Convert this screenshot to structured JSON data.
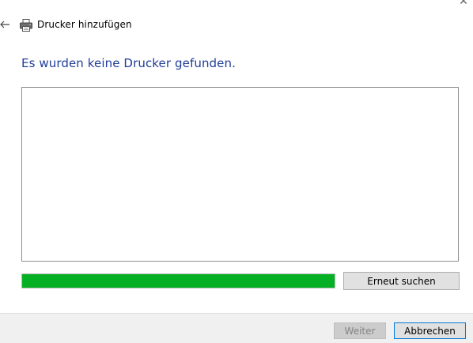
{
  "window": {
    "close_icon": "close-icon",
    "close_glyph": "✕"
  },
  "header": {
    "back_icon": "back-arrow-icon",
    "printer_icon": "printer-icon",
    "title": "Drucker hinzufügen"
  },
  "main": {
    "heading": "Es wurden keine Drucker gefunden.",
    "results": [],
    "progress": {
      "fraction": 1.0,
      "color": "#06b025"
    },
    "search_again_label": "Erneut suchen"
  },
  "footer": {
    "next_label": "Weiter",
    "next_enabled": false,
    "cancel_label": "Abbrechen"
  },
  "colors": {
    "heading": "#1f3d9a",
    "accent_focus": "#0078d7"
  }
}
